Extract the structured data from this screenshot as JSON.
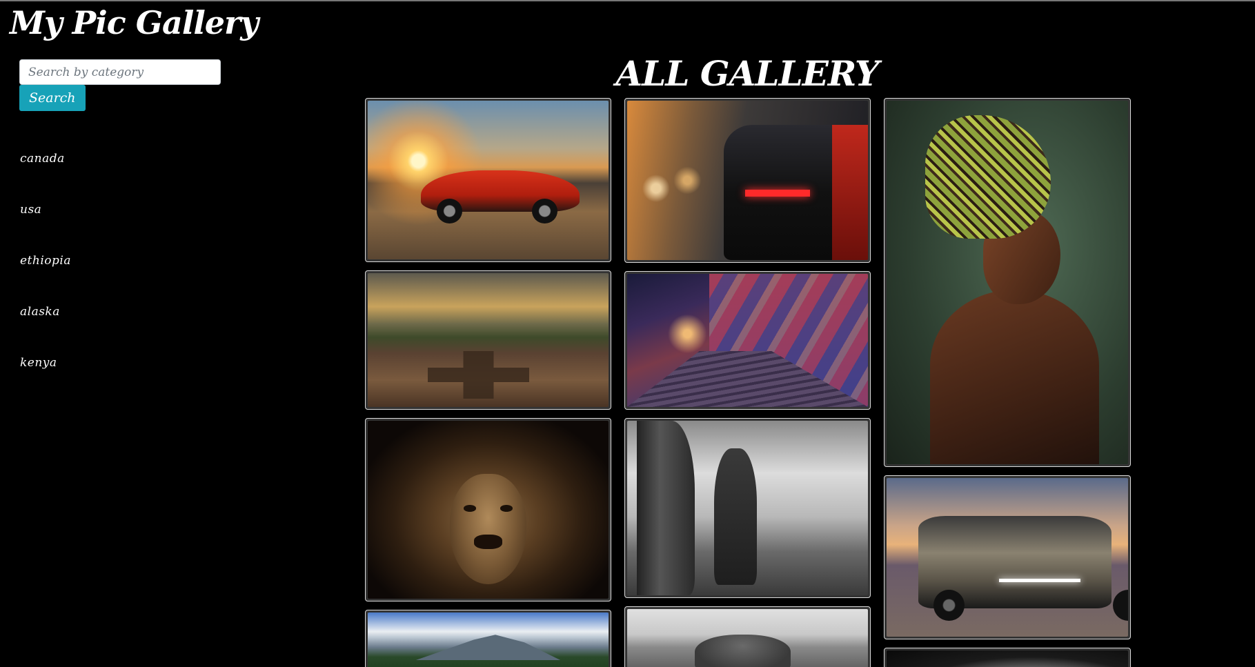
{
  "header": {
    "brand": "My Pic Gallery"
  },
  "search": {
    "placeholder": "Search by category",
    "value": "",
    "button_label": "Search"
  },
  "categories": [
    {
      "label": "canada"
    },
    {
      "label": "usa"
    },
    {
      "label": "ethiopia"
    },
    {
      "label": "alaska"
    },
    {
      "label": "kenya"
    }
  ],
  "main": {
    "title": "ALL GALLERY"
  },
  "colors": {
    "background": "#000000",
    "accent": "#17a2b8",
    "text": "#ffffff",
    "card_border": "#dddddd"
  }
}
